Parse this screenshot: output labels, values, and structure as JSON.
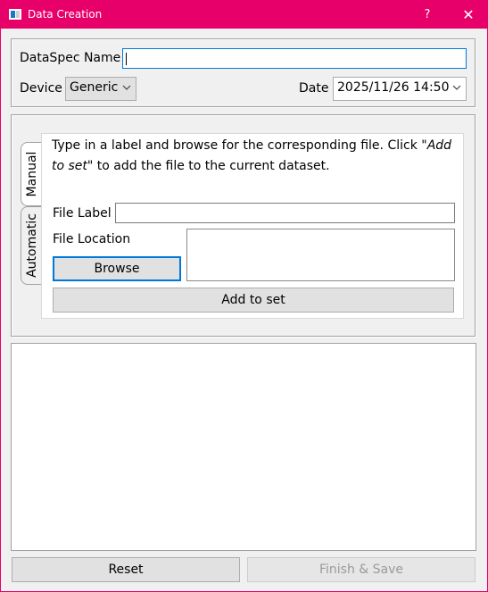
{
  "window": {
    "title": "Data Creation",
    "help_glyph": "?",
    "close_glyph": "✕"
  },
  "spec": {
    "name_label": "DataSpec Name",
    "name_value": "",
    "device_label": "Device",
    "device_value": "Generic",
    "date_label": "Date",
    "date_value": "2025/11/26 14:50"
  },
  "tabs": [
    {
      "label": "Manual",
      "active": true
    },
    {
      "label": "Automatic",
      "active": false
    }
  ],
  "manual": {
    "instructions_prefix": "Type in a label and browse for the corresponding file. Click \"",
    "instructions_em": "Add to set",
    "instructions_suffix": "\" to add the file to the current dataset.",
    "file_label_label": "File Label",
    "file_label_value": "",
    "file_location_label": "File Location",
    "file_location_value": "",
    "browse_label": "Browse",
    "add_label": "Add to set"
  },
  "dataset_list": [],
  "footer": {
    "reset_label": "Reset",
    "finish_label": "Finish & Save"
  },
  "colors": {
    "titlebar": "#e8006a",
    "focus_accent": "#0078d7"
  },
  "icons": {
    "app": "app-icon",
    "dropdown": "chevron-down-icon"
  }
}
